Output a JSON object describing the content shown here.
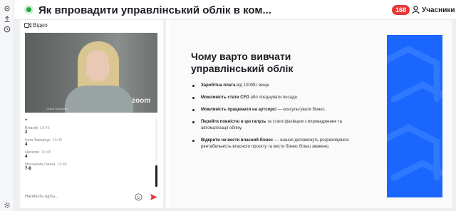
{
  "header": {
    "title": "Як впровадити управлінський облік в ком...",
    "participant_count": "168",
    "participants_label": "Учасники"
  },
  "video": {
    "label": "Відео",
    "tile_name": "Ольга Горелова",
    "zoom_logo": "zoom"
  },
  "chat": {
    "messages": [
      {
        "author": "",
        "time": "",
        "text": "+"
      },
      {
        "author": "Віталій",
        "time": "19:45",
        "text": "2"
      },
      {
        "author": "Ілля Захарчук",
        "time": "19:45",
        "text": "4"
      },
      {
        "author": "Наталія",
        "time": "19:45",
        "text": "4"
      },
      {
        "author": "Москалюк Ганна",
        "time": "19:46",
        "text": "7-8"
      }
    ],
    "input_placeholder": "Напишіть щось..."
  },
  "slide": {
    "title": "Чому варто вивчати управлінський облік",
    "bullets": [
      {
        "bold": "Заробітна плата",
        "rest": " від 1000$ і вище"
      },
      {
        "bold": "Можливість стати CFO",
        "rest": " або поєднувати посади."
      },
      {
        "bold": "Можливість працювати на аутсорсі",
        "rest": " — консультувати бізнес."
      },
      {
        "bold": "Перейти повністю в цю галузь",
        "rest": " та стати фахівцем з впровадження та автоматизації обліку."
      },
      {
        "bold": "Відкрити чи вести власний бізнес",
        "rest": " — знання допоможуть розраховувати рентабельність власного проєкту та вести бізнес більш зважено."
      }
    ]
  },
  "colors": {
    "accent_blue": "#1a66ff",
    "live_green": "#21a747",
    "badge_red": "#e53935",
    "send_red": "#e53935"
  },
  "icons": {
    "rail": [
      "gear-icon",
      "upload-icon",
      "clock-icon",
      "settings-icon"
    ],
    "video": "camera-icon",
    "participants": "user-icon",
    "emoji": "smiley-icon",
    "send": "send-icon"
  }
}
